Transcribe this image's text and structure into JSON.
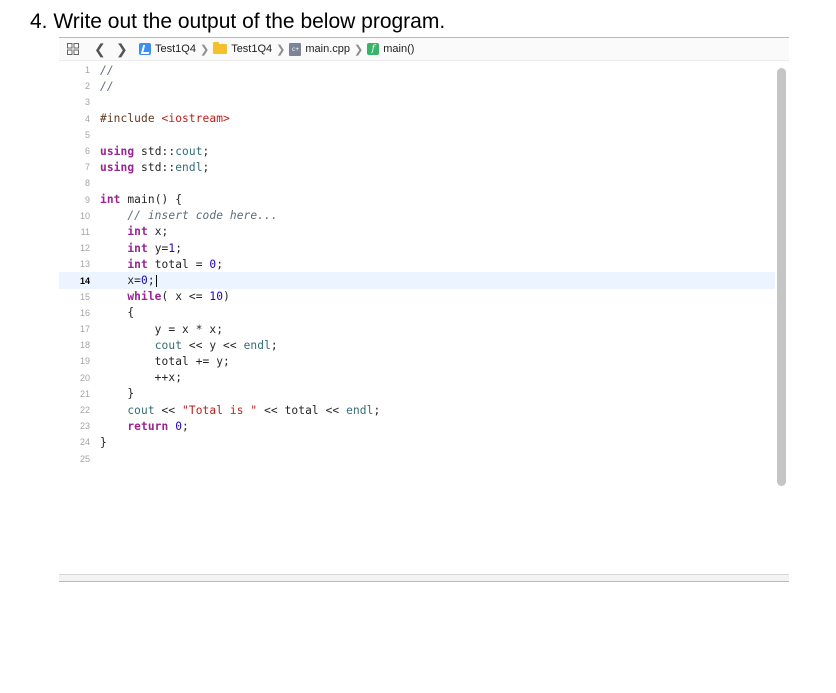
{
  "question": "4.  Write out the output of the below program.",
  "jumpbar": {
    "crumbs": [
      "Test1Q4",
      "Test1Q4",
      "main.cpp",
      "main()"
    ]
  },
  "code": {
    "current_line": 14,
    "lines": [
      {
        "n": "1",
        "text": "//"
      },
      {
        "n": "2",
        "text": "//"
      },
      {
        "n": "3",
        "text": ""
      },
      {
        "n": "4",
        "text": "#include <iostream>"
      },
      {
        "n": "5",
        "text": ""
      },
      {
        "n": "6",
        "text": "using std::cout;"
      },
      {
        "n": "7",
        "text": "using std::endl;"
      },
      {
        "n": "8",
        "text": ""
      },
      {
        "n": "9",
        "text": "int main() {"
      },
      {
        "n": "10",
        "text": "    // insert code here..."
      },
      {
        "n": "11",
        "text": "    int x;"
      },
      {
        "n": "12",
        "text": "    int y=1;"
      },
      {
        "n": "13",
        "text": "    int total = 0;"
      },
      {
        "n": "14",
        "text": "    x=0;"
      },
      {
        "n": "15",
        "text": "    while( x <= 10)"
      },
      {
        "n": "16",
        "text": "    {"
      },
      {
        "n": "17",
        "text": "        y = x * x;"
      },
      {
        "n": "18",
        "text": "        cout << y << endl;"
      },
      {
        "n": "19",
        "text": "        total += y;"
      },
      {
        "n": "20",
        "text": "        ++x;"
      },
      {
        "n": "21",
        "text": "    }"
      },
      {
        "n": "22",
        "text": "    cout << \"Total is \" << total << endl;"
      },
      {
        "n": "23",
        "text": "    return 0;"
      },
      {
        "n": "24",
        "text": "}"
      },
      {
        "n": "25",
        "text": ""
      }
    ]
  },
  "icons": {
    "grid": "grid-icon",
    "back": "chevron-left-icon",
    "forward": "chevron-right-icon",
    "project": "xcode-project-icon",
    "folder": "folder-icon",
    "file": "cpp-file-icon",
    "function": "function-icon"
  }
}
